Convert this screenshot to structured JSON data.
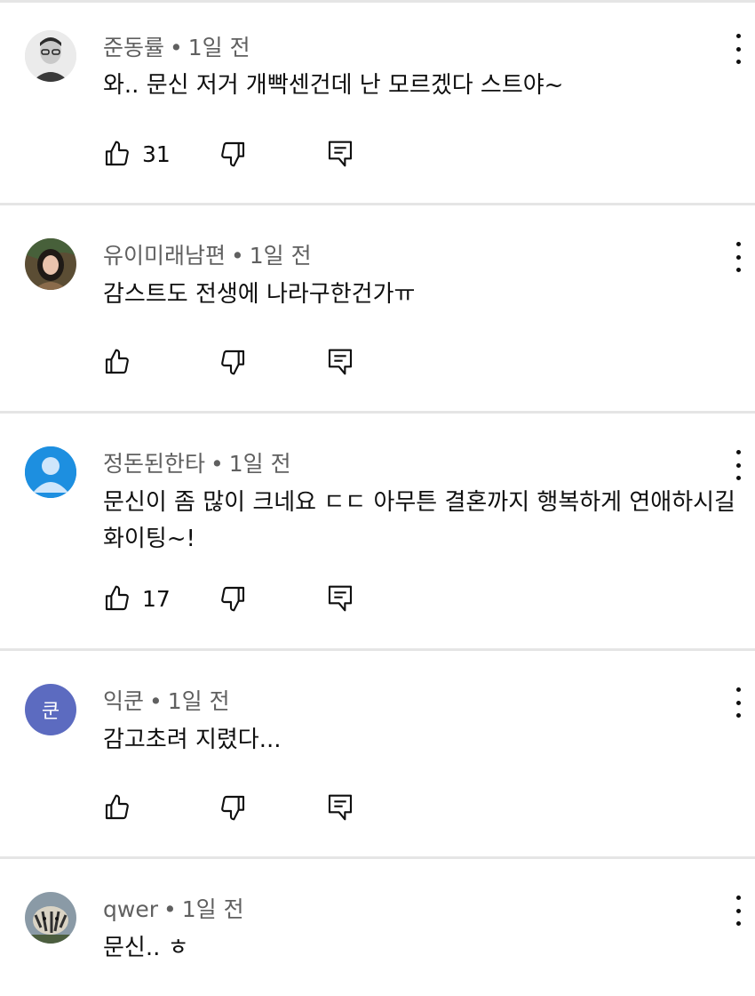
{
  "comments": [
    {
      "author": "준동률",
      "time": "1일 전",
      "text": "와.. 문신 저거 개빡센건데 난 모르겠다 스트야~",
      "likes": "31",
      "avatar": {
        "type": "photo",
        "color": "#d8d8d8"
      }
    },
    {
      "author": "유이미래남편",
      "time": "1일 전",
      "text": "감스트도 전생에 나라구한건가ㅠ",
      "likes": "",
      "avatar": {
        "type": "photo",
        "color": "#6b5a3e"
      }
    },
    {
      "author": "정돈된한타",
      "time": "1일 전",
      "text": "문신이 좀 많이 크네요 ㄷㄷ 아무튼 결혼까지 행복하게 연애하시길 화이팅~!",
      "likes": "17",
      "avatar": {
        "type": "default",
        "color": "#1d8fe0"
      }
    },
    {
      "author": "익쿤",
      "time": "1일 전",
      "text": "감고초려 지렸다...",
      "likes": "",
      "avatar": {
        "type": "letter",
        "letter": "쿤",
        "color": "#5c6bc0"
      }
    },
    {
      "author": "qwer",
      "time": "1일 전",
      "text": "문신.. ㅎ",
      "likes": "",
      "avatar": {
        "type": "photo",
        "color": "#6f7c86"
      }
    }
  ],
  "separator": "•"
}
